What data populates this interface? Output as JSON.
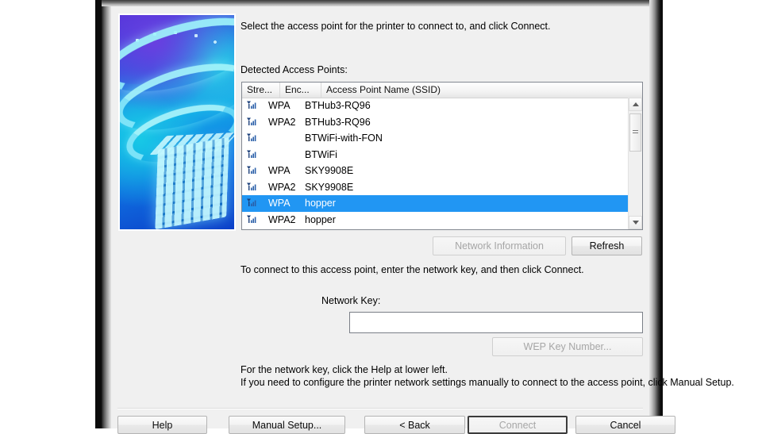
{
  "dialog": {
    "instruction_top": "Select the access point for the printer to connect to, and click Connect.",
    "detected_label": "Detected Access Points:",
    "instruction_mid": "To connect to this access point, enter the network key, and then click Connect.",
    "instruction_bottom": "For the network key, click the Help at lower left.\nIf you need to configure the printer network settings manually to connect to the access point, click Manual Setup.",
    "illustration_name": "wireless-network-illustration"
  },
  "list": {
    "columns": [
      "Stre...",
      "Enc...",
      "Access Point Name (SSID)"
    ],
    "rows": [
      {
        "icon": "signal-strength-icon",
        "encryption": "WPA",
        "ssid": "BTHub3-RQ96",
        "selected": false
      },
      {
        "icon": "signal-strength-icon",
        "encryption": "WPA2",
        "ssid": "BTHub3-RQ96",
        "selected": false
      },
      {
        "icon": "signal-strength-icon",
        "encryption": "",
        "ssid": "BTWiFi-with-FON",
        "selected": false
      },
      {
        "icon": "signal-strength-icon",
        "encryption": "",
        "ssid": "BTWiFi",
        "selected": false
      },
      {
        "icon": "signal-strength-icon",
        "encryption": "WPA",
        "ssid": "SKY9908E",
        "selected": false
      },
      {
        "icon": "signal-strength-icon",
        "encryption": "WPA2",
        "ssid": "SKY9908E",
        "selected": false
      },
      {
        "icon": "signal-strength-icon",
        "encryption": "WPA",
        "ssid": "hopper",
        "selected": true
      },
      {
        "icon": "signal-strength-icon",
        "encryption": "WPA2",
        "ssid": "hopper",
        "selected": false
      }
    ],
    "selection_color": "#2196f3",
    "scrollbar": {
      "up_arrow": "scroll-up-arrow-icon",
      "down_arrow": "scroll-down-arrow-icon",
      "thumb": "scrollbar-thumb"
    }
  },
  "buttons": {
    "network_information": "Network Information",
    "refresh": "Refresh",
    "wep_key_number": "WEP Key Number...",
    "help": "Help",
    "manual_setup": "Manual Setup...",
    "back": "< Back",
    "connect": "Connect",
    "cancel": "Cancel"
  },
  "network_key": {
    "label": "Network Key:",
    "value": "",
    "placeholder": ""
  }
}
